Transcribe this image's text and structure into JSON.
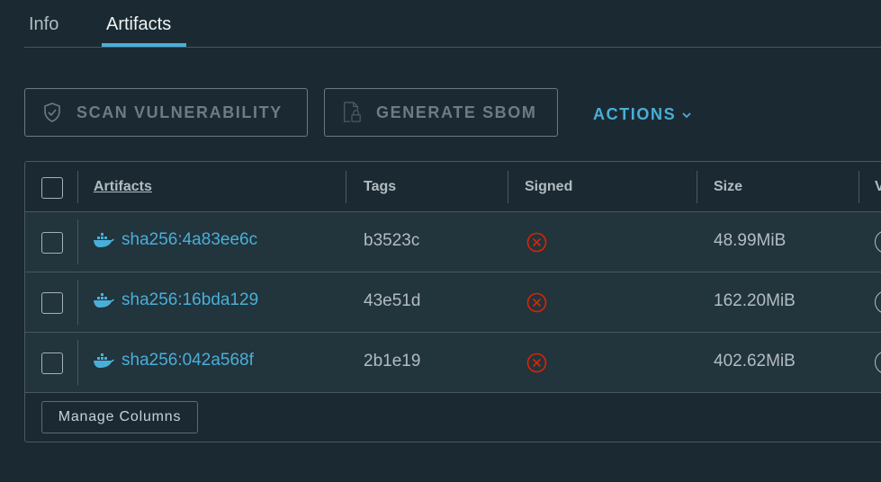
{
  "tabs": [
    {
      "label": "Info",
      "active": false
    },
    {
      "label": "Artifacts",
      "active": true
    }
  ],
  "toolbar": {
    "scan_label": "SCAN VULNERABILITY",
    "scan_icon": "shield-check-icon",
    "sbom_label": "GENERATE SBOM",
    "sbom_icon": "document-lock-icon",
    "actions_label": "ACTIONS"
  },
  "table": {
    "columns": [
      "Artifacts",
      "Tags",
      "Signed",
      "Size",
      "V"
    ],
    "rows": [
      {
        "digest": "sha256:4a83ee6c",
        "tag": "b3523c",
        "signed": "not-signed",
        "size": "48.99MiB"
      },
      {
        "digest": "sha256:16bda129",
        "tag": "43e51d",
        "signed": "not-signed",
        "size": "162.20MiB"
      },
      {
        "digest": "sha256:042a568f",
        "tag": "2b1e19",
        "signed": "not-signed",
        "size": "402.62MiB"
      }
    ],
    "footer_button": "Manage Columns"
  },
  "colors": {
    "background": "#1b2a32",
    "row_background": "#22343c",
    "accent": "#49afd9",
    "error": "#e12200"
  }
}
